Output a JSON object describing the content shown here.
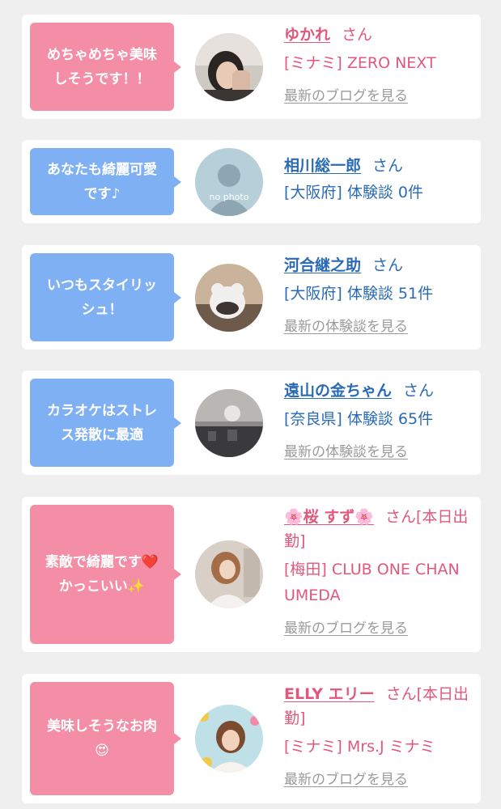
{
  "entries": [
    {
      "message": "めちゃめちゃ美味\nしそうです！！",
      "name": "ゆかれ",
      "honorific": "さん",
      "location": "[ミナミ] ZERO NEXT",
      "link": "最新のブログを見る",
      "theme": "pink"
    },
    {
      "message": "あなたも綺麗可愛\nです♪",
      "name": "相川総一郎",
      "honorific": "さん",
      "location": "[大阪府] 体験談 0件",
      "avatar_label": "no photo",
      "theme": "blue"
    },
    {
      "message": "いつもスタイリッ\nシュ！",
      "name": "河合継之助",
      "honorific": "さん",
      "location": "[大阪府] 体験談 51件",
      "link": "最新の体験談を見る",
      "theme": "blue"
    },
    {
      "message": "カラオケはストレ\nス発散に最適",
      "name": "遠山の金ちゃん",
      "honorific": "さん",
      "location": "[奈良県] 体験談 65件",
      "link": "最新の体験談を見る",
      "theme": "blue"
    },
    {
      "message": "素敵で綺麗です❤️\nかっこいい✨",
      "name": "🌸桜 すず🌸",
      "honorific": "さん[本日出勤]",
      "location": "[梅田] CLUB ONE CHAN UMEDA",
      "link": "最新のブログを見る",
      "theme": "pink"
    },
    {
      "message": "美味しそうなお肉\n😍",
      "name": "ELLY エリー",
      "honorific": "さん[本日出勤]",
      "location": "[ミナミ] Mrs.J ミナミ",
      "link": "最新のブログを見る",
      "theme": "pink"
    }
  ]
}
